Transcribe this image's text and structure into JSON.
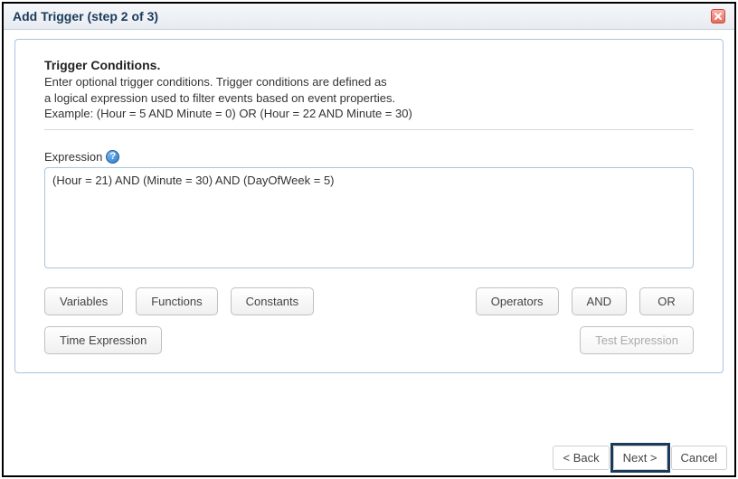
{
  "dialog": {
    "title": "Add Trigger (step 2 of 3)"
  },
  "section": {
    "title": "Trigger Conditions.",
    "desc1": "Enter optional trigger conditions. Trigger conditions are defined as",
    "desc2": "a logical expression used to filter events based on event properties.",
    "desc3": "Example: (Hour = 5 AND Minute = 0) OR (Hour = 22 AND Minute = 30)"
  },
  "expression": {
    "label": "Expression",
    "value": "(Hour = 21) AND (Minute = 30) AND (DayOfWeek = 5)",
    "help_symbol": "?"
  },
  "buttons": {
    "variables": "Variables",
    "functions": "Functions",
    "constants": "Constants",
    "operators": "Operators",
    "and": "AND",
    "or": "OR",
    "time_expression": "Time Expression",
    "test_expression": "Test Expression"
  },
  "footer": {
    "back": "< Back",
    "next": "Next >",
    "cancel": "Cancel"
  }
}
